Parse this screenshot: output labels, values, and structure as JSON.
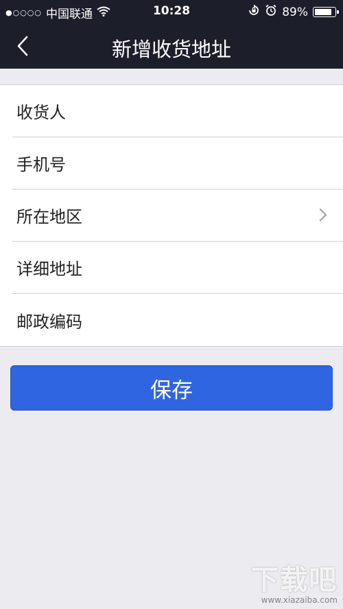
{
  "status_bar": {
    "signal_dots": "●○○○○",
    "carrier": "中国联通",
    "time": "10:28",
    "battery_percent_text": "89%",
    "battery_level": 0.89
  },
  "nav": {
    "title": "新增收货地址",
    "back_icon": "chevron-left-icon"
  },
  "form": {
    "rows": [
      {
        "label": "收货人"
      },
      {
        "label": "手机号"
      },
      {
        "label": "所在地区",
        "icon": "chevron-right-icon"
      },
      {
        "label": "详细地址"
      },
      {
        "label": "邮政编码"
      }
    ]
  },
  "save_button": {
    "label": "保存"
  },
  "watermark": {
    "big": "下载吧",
    "small": "www.xiazaiba.com"
  },
  "colors": {
    "navbar": "#1c1e2a",
    "background": "#ebebf0",
    "accent": "#2f65e0"
  }
}
